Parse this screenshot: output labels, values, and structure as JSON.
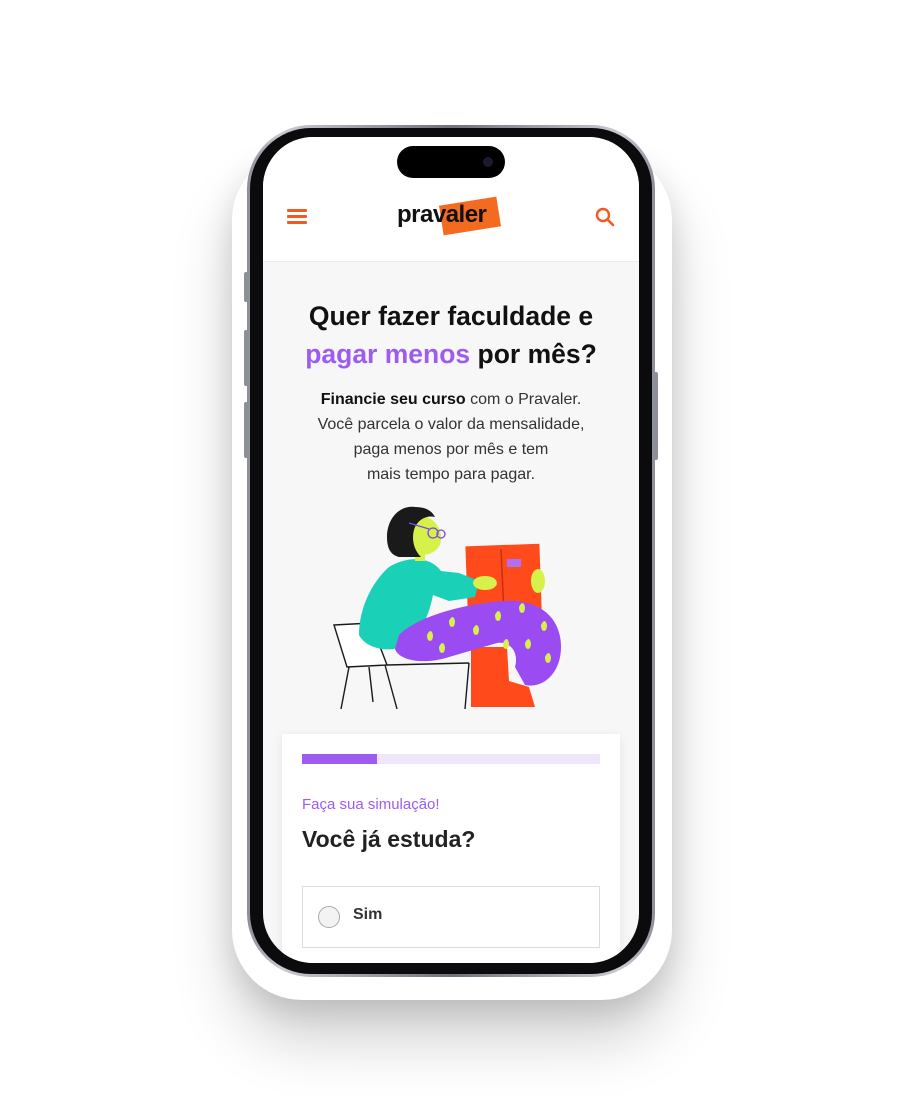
{
  "header": {
    "logo_text": "pravaler",
    "menu_icon": "hamburger-icon",
    "search_icon": "search-icon"
  },
  "hero": {
    "title_line1": "Quer fazer faculdade e",
    "title_accent": "pagar menos",
    "title_rest": " por mês?",
    "text_bold": "Financie seu curso",
    "text_line1_rest": " com o Pravaler.",
    "text_line2": "Você parcela o valor da mensalidade,",
    "text_line3": "paga menos por mês e tem",
    "text_line4": "mais tempo para pagar."
  },
  "simulation": {
    "progress": 0.25,
    "kicker": "Faça sua simulação!",
    "question": "Você já estuda?",
    "options": [
      {
        "label": "Sim",
        "selected": false
      }
    ]
  },
  "colors": {
    "brand_orange": "#f15a22",
    "accent_purple": "#9d5cf0",
    "progress_track": "#efe6fb"
  }
}
